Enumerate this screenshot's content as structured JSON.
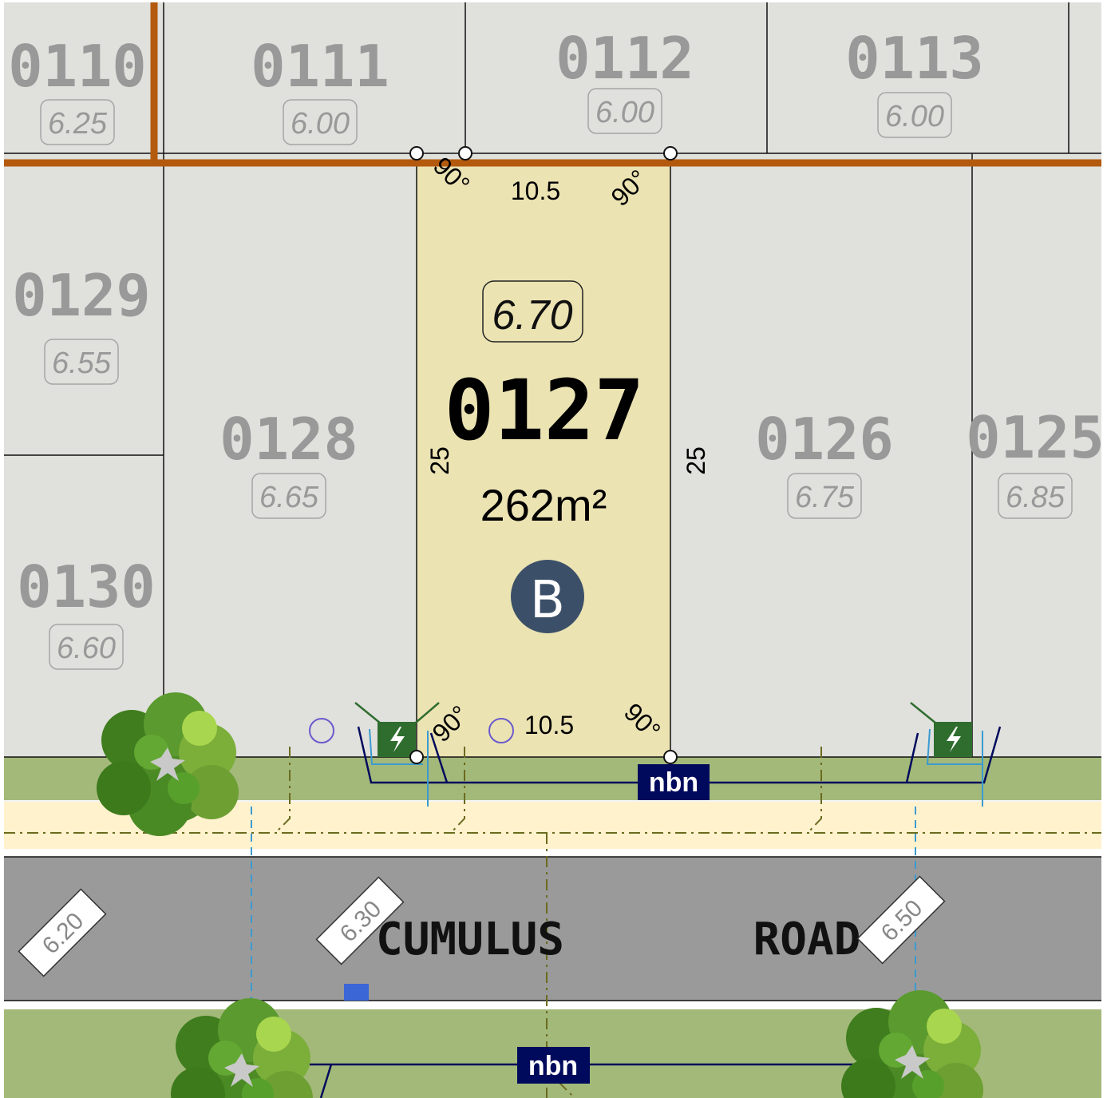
{
  "colors": {
    "lot_fill": "#e0e0dc",
    "selected_lot_fill": "#ece3b3",
    "boundary_orange": "#b35a0e",
    "verge_green": "#a3b979",
    "footpath": "#fff2cd",
    "road_grey": "#9a9a9a",
    "nbn_navy": "#000a5c",
    "badge_slate": "#3b5068",
    "power_green": "#2f6d2f"
  },
  "lots": [
    {
      "number": "0110",
      "level": "6.25"
    },
    {
      "number": "0111",
      "level": "6.00"
    },
    {
      "number": "0112",
      "level": "6.00"
    },
    {
      "number": "0113",
      "level": "6.00"
    },
    {
      "number": "0129",
      "level": "6.55"
    },
    {
      "number": "0130",
      "level": "6.60"
    },
    {
      "number": "0128",
      "level": "6.65"
    },
    {
      "number": "0126",
      "level": "6.75"
    },
    {
      "number": "0125",
      "level": "6.85"
    }
  ],
  "selected_lot": {
    "number": "0127",
    "area": "262m²",
    "level": "6.70",
    "badge": "B",
    "frontage_top": "10.5",
    "frontage_bottom": "10.5",
    "depth_left": "25",
    "depth_right": "25",
    "angle": "90°"
  },
  "street": {
    "name_part1": "CUMULUS",
    "name_part2": "ROAD",
    "levels": [
      "6.20",
      "6.30",
      "6.50"
    ]
  },
  "nbn_label": "nbn",
  "icons": [
    "power-pit-icon",
    "tree-icon",
    "service-pit-icon",
    "survey-peg-icon",
    "nbn-pit-icon"
  ]
}
